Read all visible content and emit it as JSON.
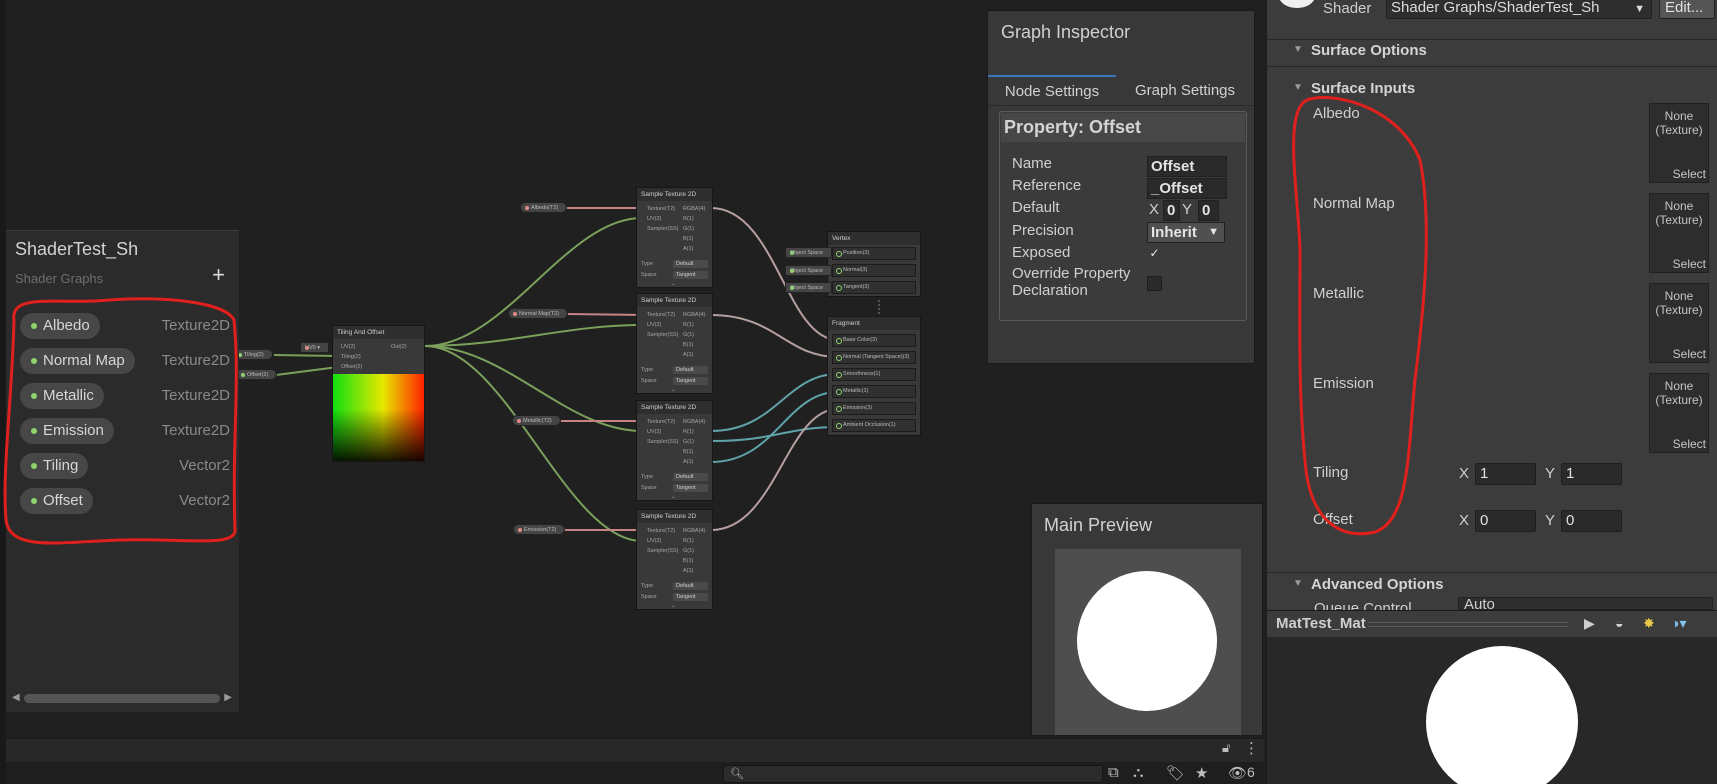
{
  "blackboard": {
    "title": "ShaderTest_Sh",
    "subtitle": "Shader Graphs",
    "add_label": "+",
    "properties": [
      {
        "name": "Albedo",
        "type": "Texture2D"
      },
      {
        "name": "Normal Map",
        "type": "Texture2D"
      },
      {
        "name": "Metallic",
        "type": "Texture2D"
      },
      {
        "name": "Emission",
        "type": "Texture2D"
      },
      {
        "name": "Tiling",
        "type": "Vector2"
      },
      {
        "name": "Offset",
        "type": "Vector2"
      }
    ]
  },
  "graph": {
    "tiling_node": {
      "title": "Tiling And Offset",
      "in_uv": "UV(2)",
      "in_tiling": "Tiling(2)",
      "in_offset": "Offset(2)",
      "out": "Out(2)",
      "uv_dropdown": "UV0",
      "tiling_chip": "Tiling(2)",
      "offset_chip": "Offset(2)"
    },
    "sample_nodes": [
      {
        "title": "Sample Texture 2D",
        "chip": "Albedo(T2)",
        "type": "Default",
        "space": "Tangent"
      },
      {
        "title": "Sample Texture 2D",
        "chip": "Normal Map(T2)",
        "type": "Default",
        "space": "Tangent"
      },
      {
        "title": "Sample Texture 2D",
        "chip": "Metallic(T2)",
        "type": "Default",
        "space": "Tangent"
      },
      {
        "title": "Sample Texture 2D",
        "chip": "Emission(T2)",
        "type": "Default",
        "space": "Tangent"
      }
    ],
    "sample_ports": {
      "in": [
        "Texture(T2)",
        "UV(2)",
        "Sampler(SS)"
      ],
      "out": [
        "RGBA(4)",
        "R(1)",
        "G(1)",
        "B(1)",
        "A(1)"
      ],
      "type_label": "Type",
      "space_label": "Space"
    },
    "vertex": {
      "title": "Vertex",
      "slots": [
        "Position(3)",
        "Normal(3)",
        "Tangent(3)"
      ],
      "space_chip": "Object Space"
    },
    "fragment": {
      "title": "Fragment",
      "slots": [
        "Base Color(3)",
        "Normal (Tangent Space)(3)",
        "Smoothness(1)",
        "Metallic(1)",
        "Emission(3)",
        "Ambient Occlusion(1)"
      ]
    }
  },
  "inspector": {
    "title": "Graph Inspector",
    "tabs": [
      "Node Settings",
      "Graph Settings"
    ],
    "property_header": "Property: Offset",
    "fields": {
      "name_label": "Name",
      "name_value": "Offset",
      "reference_label": "Reference",
      "reference_value": "_Offset",
      "default_label": "Default",
      "default_x_label": "X",
      "default_x": "0",
      "default_y_label": "Y",
      "default_y": "0",
      "precision_label": "Precision",
      "precision_value": "Inherit",
      "exposed_label": "Exposed",
      "exposed_check": "✓",
      "override_label_1": "Override Property",
      "override_label_2": "Declaration"
    }
  },
  "main_preview": {
    "title": "Main Preview"
  },
  "material": {
    "shader_label": "Shader",
    "shader_value": "Shader Graphs/ShaderTest_Sh",
    "edit_label": "Edit...",
    "surface_options": "Surface Options",
    "surface_inputs": "Surface Inputs",
    "texture_inputs": [
      "Albedo",
      "Normal Map",
      "Metallic",
      "Emission"
    ],
    "texture_none_1": "None",
    "texture_none_2": "(Texture)",
    "texture_select": "Select",
    "tiling_label": "Tiling",
    "tiling_x": "1",
    "tiling_y": "1",
    "offset_label": "Offset",
    "offset_x": "0",
    "offset_y": "0",
    "x_label": "X",
    "y_label": "Y",
    "advanced_options": "Advanced Options",
    "queue_label": "Queue Control",
    "queue_value": "Auto"
  },
  "material_preview": {
    "title": "MatTest_Mat"
  },
  "status": {
    "hidden_count": "6"
  },
  "colors": {
    "highlight_red": "#e0201c",
    "port_green": "#8ed36d",
    "port_pink": "#e28b8b",
    "edge_green": "#7ba05b",
    "edge_pink": "#c68383",
    "edge_teal": "#5fa3a8",
    "accent_blue": "#3a79bb"
  }
}
